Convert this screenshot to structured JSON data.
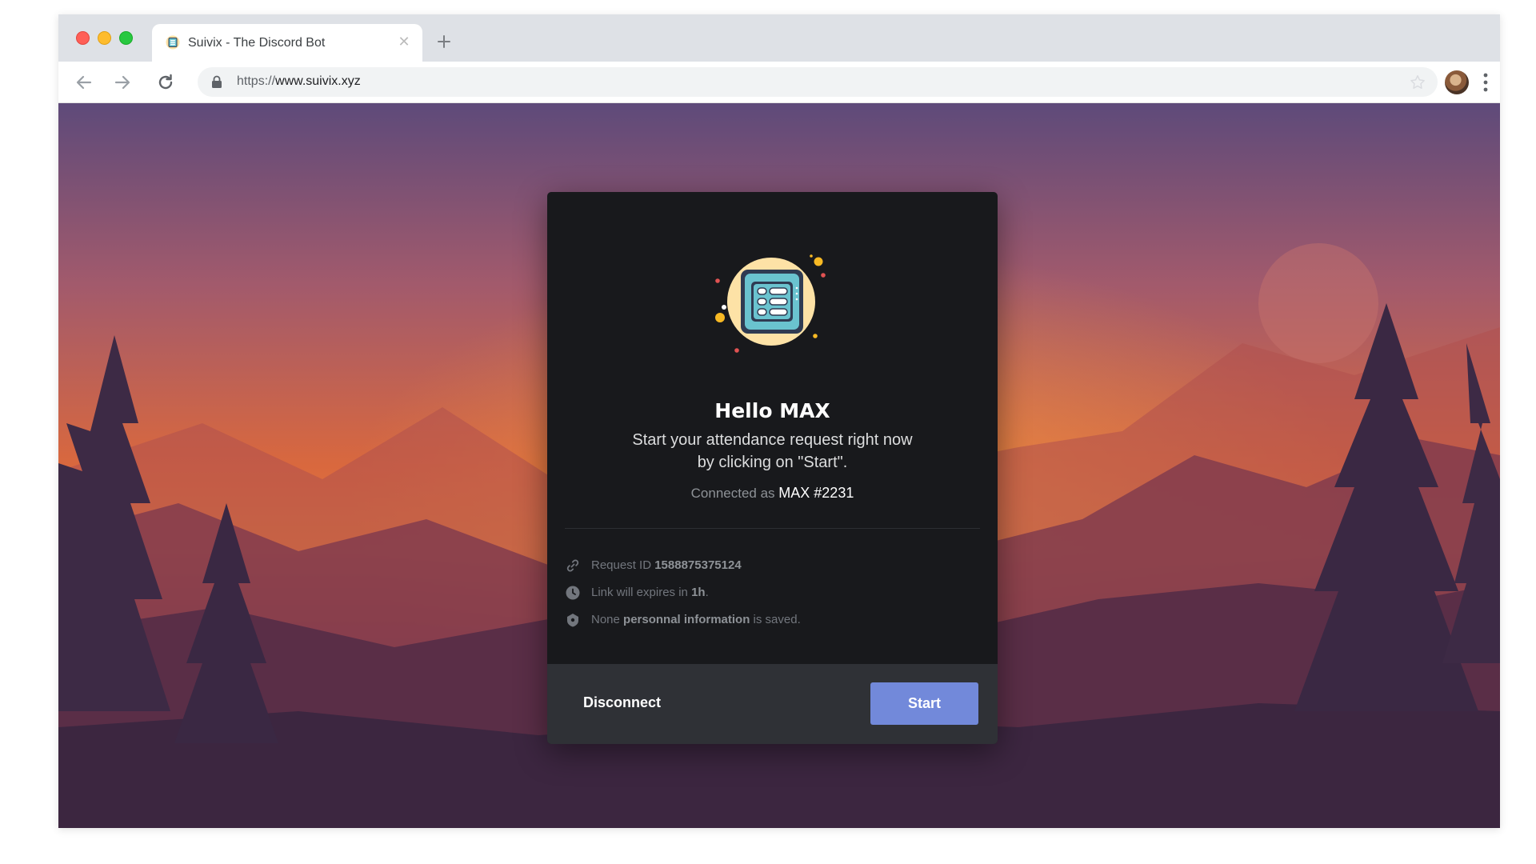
{
  "browser": {
    "tab_title": "Suivix - The Discord Bot",
    "url_scheme": "https://",
    "url_host": "www.suivix.xyz"
  },
  "modal": {
    "greeting": "Hello MAX",
    "subtitle_line1": "Start your attendance request right now",
    "subtitle_line2": "by clicking on \"Start\".",
    "connected_prefix": "Connected as",
    "connected_user": "MAX #2231",
    "request_id_label": "Request ID",
    "request_id_value": "1588875375124",
    "expires_prefix": "Link will expires in",
    "expires_value": "1h",
    "expires_suffix": ".",
    "privacy_prefix": "None",
    "privacy_bold": "personnal information",
    "privacy_suffix": "is saved.",
    "disconnect_label": "Disconnect",
    "start_label": "Start"
  },
  "icons": {
    "favicon": "suivix-favicon-icon",
    "logo": "suivix-logo-icon",
    "request": "link-icon",
    "expires": "clock-icon",
    "privacy": "shield-icon"
  },
  "colors": {
    "modal_bg": "#18191c",
    "footer_bg": "#2f3136",
    "start_button": "#7289da"
  }
}
